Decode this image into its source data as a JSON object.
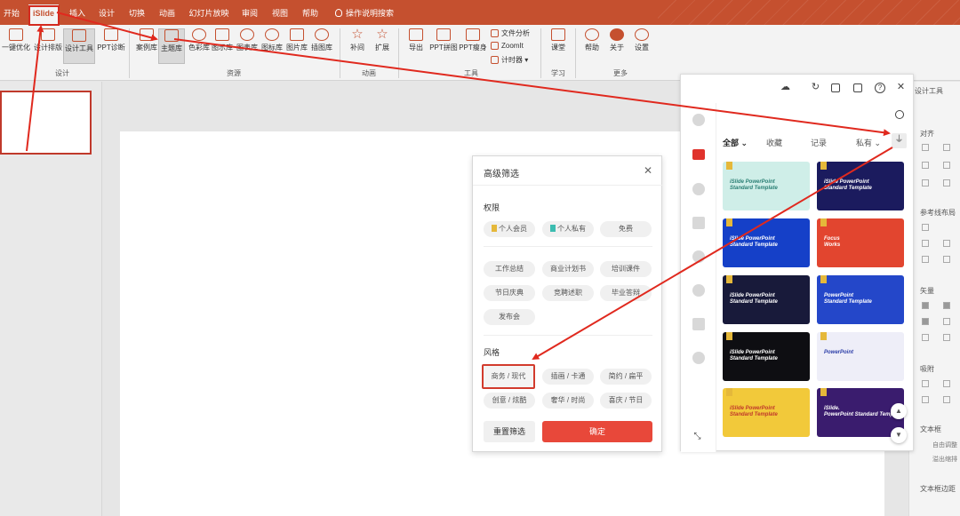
{
  "tabs": [
    "开始",
    "iSlide",
    "插入",
    "设计",
    "切换",
    "动画",
    "幻灯片放映",
    "审阅",
    "视图",
    "帮助",
    "操作说明搜索"
  ],
  "ribbon": {
    "buttons": [
      "一键优化",
      "设计排版",
      "设计工具",
      "PPT诊断",
      "案例库",
      "主题库",
      "色彩库",
      "图示库",
      "图表库",
      "图标库",
      "图片库",
      "插图库",
      "补间",
      "扩展",
      "导出",
      "PPT拼图",
      "PPT瘦身",
      "课堂",
      "帮助",
      "关于",
      "设置"
    ],
    "mini": [
      "文件分析",
      "ZoomIt",
      "计时器"
    ],
    "groups": [
      "设计",
      "资源",
      "动画",
      "工具",
      "学习",
      "更多"
    ]
  },
  "panel": {
    "filters": [
      "全部",
      "收藏",
      "记录",
      "私有"
    ],
    "cards": [
      {
        "title": "iSlide PowerPoint\nStandard Template",
        "bg": "#cfeee8",
        "text": "#2a7f74"
      },
      {
        "title": "iSlide PowerPoint\nStandard Template",
        "bg": "#1b1b5e",
        "text": "#ffffff"
      },
      {
        "title": "iSlide PowerPoint\nStandard Template",
        "bg": "#1540c8",
        "text": "#ffffff"
      },
      {
        "title": "Focus\nWorks",
        "bg": "#e2452f",
        "text": "#ffffff"
      },
      {
        "title": "iSlide PowerPoint\nStandard Template",
        "bg": "#181a3a",
        "text": "#ffffff"
      },
      {
        "title": "PowerPoint\nStandard Template",
        "bg": "#2447c9",
        "text": "#ffffff"
      },
      {
        "title": "iSlide PowerPoint\nStandard Template",
        "bg": "#0e0e12",
        "text": "#ffffff"
      },
      {
        "title": "PowerPoint",
        "bg": "#eeeef8",
        "text": "#2c3ea8"
      },
      {
        "title": "iSlide PowerPoint\nStandard Template",
        "bg": "#f2c93a",
        "text": "#c0392b"
      },
      {
        "title": "iSlide.\nPowerPoint Standard Template",
        "bg": "#3a1c6e",
        "text": "#ffffff"
      }
    ]
  },
  "dialog": {
    "title": "高级筛选",
    "section_permission": "权限",
    "permission_chips": [
      "个人会员",
      "个人私有",
      "免费"
    ],
    "category_chips": [
      "工作总结",
      "商业计划书",
      "培训课件",
      "节日庆典",
      "竞聘述职",
      "毕业答辩",
      "发布会"
    ],
    "section_style": "风格",
    "style_chips": [
      "商务 / 现代",
      "插画 / 卡通",
      "简约 / 扁平",
      "创意 / 炫酷",
      "奢华 / 时尚",
      "喜庆 / 节日"
    ],
    "reset_label": "重置筛选",
    "confirm_label": "确定"
  },
  "taskpane": {
    "title": "设计工具",
    "sections": [
      "对齐",
      "参考线布局",
      "矢量",
      "吸附",
      "文本框",
      "自由调整",
      "溢出缩排",
      "文本框边距"
    ]
  },
  "colors": {
    "accent": "#c5502f",
    "highlight": "#d23b2d",
    "primary_button": "#e8483a"
  }
}
